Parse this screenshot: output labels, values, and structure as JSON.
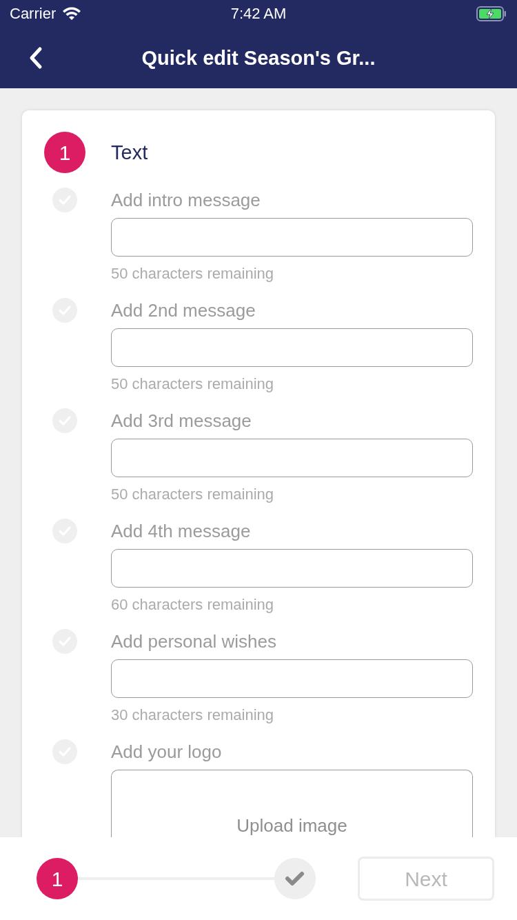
{
  "status_bar": {
    "carrier": "Carrier",
    "time": "7:42 AM"
  },
  "nav": {
    "title": "Quick edit Season's Gr..."
  },
  "step": {
    "number": "1",
    "title": "Text"
  },
  "fields": [
    {
      "kind": "text",
      "label": "Add intro message",
      "hint": "50 characters remaining",
      "checked": false
    },
    {
      "kind": "text",
      "label": "Add 2nd message",
      "hint": "50 characters remaining",
      "checked": false
    },
    {
      "kind": "text",
      "label": "Add 3rd message",
      "hint": "50 characters remaining",
      "checked": false
    },
    {
      "kind": "text",
      "label": "Add 4th message",
      "hint": "60 characters remaining",
      "checked": false
    },
    {
      "kind": "text",
      "label": "Add personal wishes",
      "hint": "30 characters remaining",
      "checked": false
    },
    {
      "kind": "upload",
      "label": "Add your logo",
      "button": "Upload image",
      "checked": false
    }
  ],
  "footer": {
    "stepper": [
      {
        "kind": "number",
        "label": "1",
        "selected": true
      },
      {
        "kind": "check",
        "selected": false
      }
    ],
    "next_button": {
      "label": "Next",
      "disabled": true
    }
  }
}
